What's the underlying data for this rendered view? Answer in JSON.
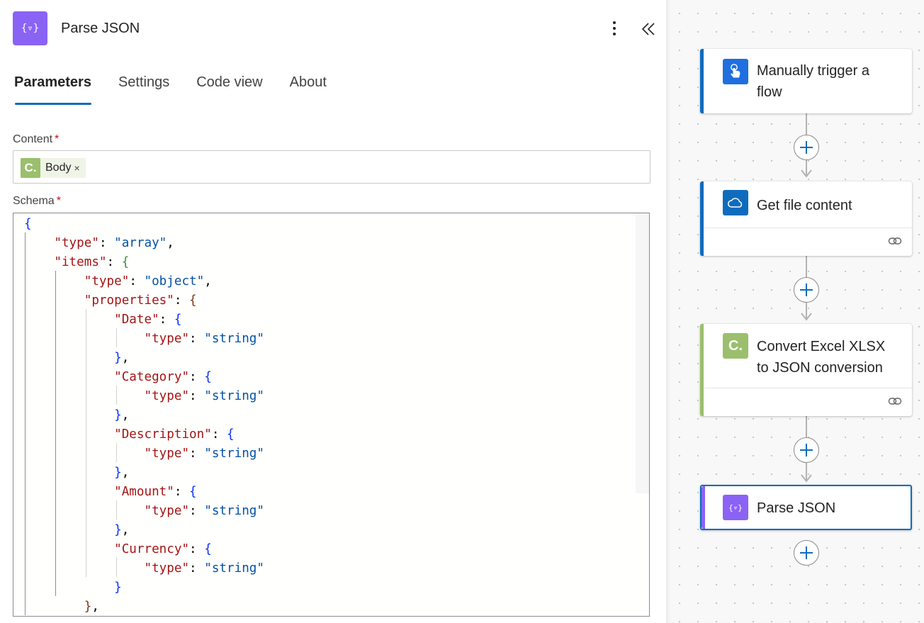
{
  "panel": {
    "icon": "parse-json-icon",
    "icon_glyph": "{▿}",
    "title": "Parse JSON",
    "tabs": [
      {
        "label": "Parameters",
        "active": true
      },
      {
        "label": "Settings",
        "active": false
      },
      {
        "label": "Code view",
        "active": false
      },
      {
        "label": "About",
        "active": false
      }
    ],
    "content": {
      "label": "Content",
      "required_mark": "*",
      "token": {
        "icon_letter": "C.",
        "label": "Body",
        "remove": "×"
      }
    },
    "schema": {
      "label": "Schema",
      "required_mark": "*"
    }
  },
  "flow": {
    "cards": [
      {
        "title_line1": "Manually trigger a",
        "title_line2": "flow",
        "icon": "touch-trigger-icon",
        "accent": "#0f6cbd"
      },
      {
        "title_line1": "Get file content",
        "icon": "onedrive-cloud-icon",
        "accent": "#0f6cbd"
      },
      {
        "title_line1": "Convert Excel XLSX",
        "title_line2": "to JSON conversion",
        "icon": "encodian-c-icon",
        "icon_letter": "C.",
        "accent": "#9bbf6c"
      },
      {
        "title_line1": "Parse JSON",
        "icon": "parse-json-icon",
        "icon_glyph": "{▿}",
        "accent": "#8a63f5"
      }
    ]
  },
  "colors": {
    "accent": "#0f6cbd",
    "parse_json": "#8a63f5",
    "encodian": "#9bbf6c",
    "required": "#c50f1f"
  }
}
